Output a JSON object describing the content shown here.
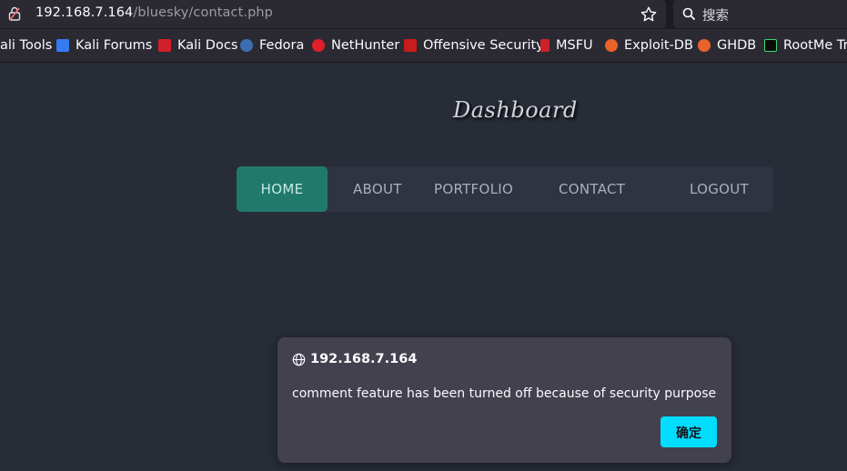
{
  "browser": {
    "url_host": "192.168.7.164",
    "url_path": "/bluesky/contact.php",
    "search_placeholder": "搜索"
  },
  "bookmarks": [
    {
      "label": "ali Tools",
      "icon": "kali-icon"
    },
    {
      "label": "Kali Forums",
      "icon": "kali-forums-icon",
      "color": "#367bf0"
    },
    {
      "label": "Kali Docs",
      "icon": "kali-docs-icon",
      "color": "#d0202a"
    },
    {
      "label": "Fedora",
      "icon": "fedora-icon",
      "color": "#3c6eb4"
    },
    {
      "label": "NetHunter",
      "icon": "nethunter-icon",
      "color": "#e0202a"
    },
    {
      "label": "Offensive Security",
      "icon": "offsec-icon",
      "color": "#c91c1c"
    },
    {
      "label": "MSFU",
      "icon": "msfu-icon",
      "color": "#d0202a"
    },
    {
      "label": "Exploit-DB",
      "icon": "exploit-db-icon",
      "color": "#e8622a"
    },
    {
      "label": "GHDB",
      "icon": "ghdb-icon",
      "color": "#e8622a"
    },
    {
      "label": "RootMe Tr",
      "icon": "rootme-icon",
      "color": "#3adb76"
    }
  ],
  "page": {
    "title": "Dashboard",
    "nav": [
      "HOME",
      "ABOUT",
      "PORTFOLIO",
      "CONTACT",
      "LOGOUT"
    ],
    "active_nav": "HOME"
  },
  "dialog": {
    "origin": "192.168.7.164",
    "message": "comment feature has been turned off because of security purpose",
    "ok_label": "确定"
  },
  "colors": {
    "accent": "#00ddff",
    "nav_active": "#1f7a6c",
    "background": "#272c37"
  }
}
